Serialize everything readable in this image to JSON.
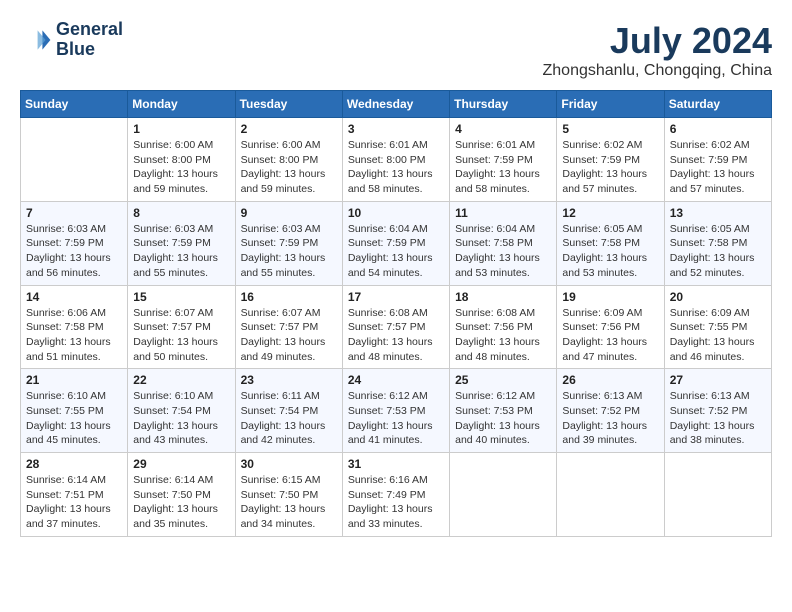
{
  "header": {
    "logo_line1": "General",
    "logo_line2": "Blue",
    "month_title": "July 2024",
    "location": "Zhongshanlu, Chongqing, China"
  },
  "weekdays": [
    "Sunday",
    "Monday",
    "Tuesday",
    "Wednesday",
    "Thursday",
    "Friday",
    "Saturday"
  ],
  "weeks": [
    [
      {
        "day": "",
        "info": ""
      },
      {
        "day": "1",
        "info": "Sunrise: 6:00 AM\nSunset: 8:00 PM\nDaylight: 13 hours\nand 59 minutes."
      },
      {
        "day": "2",
        "info": "Sunrise: 6:00 AM\nSunset: 8:00 PM\nDaylight: 13 hours\nand 59 minutes."
      },
      {
        "day": "3",
        "info": "Sunrise: 6:01 AM\nSunset: 8:00 PM\nDaylight: 13 hours\nand 58 minutes."
      },
      {
        "day": "4",
        "info": "Sunrise: 6:01 AM\nSunset: 7:59 PM\nDaylight: 13 hours\nand 58 minutes."
      },
      {
        "day": "5",
        "info": "Sunrise: 6:02 AM\nSunset: 7:59 PM\nDaylight: 13 hours\nand 57 minutes."
      },
      {
        "day": "6",
        "info": "Sunrise: 6:02 AM\nSunset: 7:59 PM\nDaylight: 13 hours\nand 57 minutes."
      }
    ],
    [
      {
        "day": "7",
        "info": "Sunrise: 6:03 AM\nSunset: 7:59 PM\nDaylight: 13 hours\nand 56 minutes."
      },
      {
        "day": "8",
        "info": "Sunrise: 6:03 AM\nSunset: 7:59 PM\nDaylight: 13 hours\nand 55 minutes."
      },
      {
        "day": "9",
        "info": "Sunrise: 6:03 AM\nSunset: 7:59 PM\nDaylight: 13 hours\nand 55 minutes."
      },
      {
        "day": "10",
        "info": "Sunrise: 6:04 AM\nSunset: 7:59 PM\nDaylight: 13 hours\nand 54 minutes."
      },
      {
        "day": "11",
        "info": "Sunrise: 6:04 AM\nSunset: 7:58 PM\nDaylight: 13 hours\nand 53 minutes."
      },
      {
        "day": "12",
        "info": "Sunrise: 6:05 AM\nSunset: 7:58 PM\nDaylight: 13 hours\nand 53 minutes."
      },
      {
        "day": "13",
        "info": "Sunrise: 6:05 AM\nSunset: 7:58 PM\nDaylight: 13 hours\nand 52 minutes."
      }
    ],
    [
      {
        "day": "14",
        "info": "Sunrise: 6:06 AM\nSunset: 7:58 PM\nDaylight: 13 hours\nand 51 minutes."
      },
      {
        "day": "15",
        "info": "Sunrise: 6:07 AM\nSunset: 7:57 PM\nDaylight: 13 hours\nand 50 minutes."
      },
      {
        "day": "16",
        "info": "Sunrise: 6:07 AM\nSunset: 7:57 PM\nDaylight: 13 hours\nand 49 minutes."
      },
      {
        "day": "17",
        "info": "Sunrise: 6:08 AM\nSunset: 7:57 PM\nDaylight: 13 hours\nand 48 minutes."
      },
      {
        "day": "18",
        "info": "Sunrise: 6:08 AM\nSunset: 7:56 PM\nDaylight: 13 hours\nand 48 minutes."
      },
      {
        "day": "19",
        "info": "Sunrise: 6:09 AM\nSunset: 7:56 PM\nDaylight: 13 hours\nand 47 minutes."
      },
      {
        "day": "20",
        "info": "Sunrise: 6:09 AM\nSunset: 7:55 PM\nDaylight: 13 hours\nand 46 minutes."
      }
    ],
    [
      {
        "day": "21",
        "info": "Sunrise: 6:10 AM\nSunset: 7:55 PM\nDaylight: 13 hours\nand 45 minutes."
      },
      {
        "day": "22",
        "info": "Sunrise: 6:10 AM\nSunset: 7:54 PM\nDaylight: 13 hours\nand 43 minutes."
      },
      {
        "day": "23",
        "info": "Sunrise: 6:11 AM\nSunset: 7:54 PM\nDaylight: 13 hours\nand 42 minutes."
      },
      {
        "day": "24",
        "info": "Sunrise: 6:12 AM\nSunset: 7:53 PM\nDaylight: 13 hours\nand 41 minutes."
      },
      {
        "day": "25",
        "info": "Sunrise: 6:12 AM\nSunset: 7:53 PM\nDaylight: 13 hours\nand 40 minutes."
      },
      {
        "day": "26",
        "info": "Sunrise: 6:13 AM\nSunset: 7:52 PM\nDaylight: 13 hours\nand 39 minutes."
      },
      {
        "day": "27",
        "info": "Sunrise: 6:13 AM\nSunset: 7:52 PM\nDaylight: 13 hours\nand 38 minutes."
      }
    ],
    [
      {
        "day": "28",
        "info": "Sunrise: 6:14 AM\nSunset: 7:51 PM\nDaylight: 13 hours\nand 37 minutes."
      },
      {
        "day": "29",
        "info": "Sunrise: 6:14 AM\nSunset: 7:50 PM\nDaylight: 13 hours\nand 35 minutes."
      },
      {
        "day": "30",
        "info": "Sunrise: 6:15 AM\nSunset: 7:50 PM\nDaylight: 13 hours\nand 34 minutes."
      },
      {
        "day": "31",
        "info": "Sunrise: 6:16 AM\nSunset: 7:49 PM\nDaylight: 13 hours\nand 33 minutes."
      },
      {
        "day": "",
        "info": ""
      },
      {
        "day": "",
        "info": ""
      },
      {
        "day": "",
        "info": ""
      }
    ]
  ]
}
